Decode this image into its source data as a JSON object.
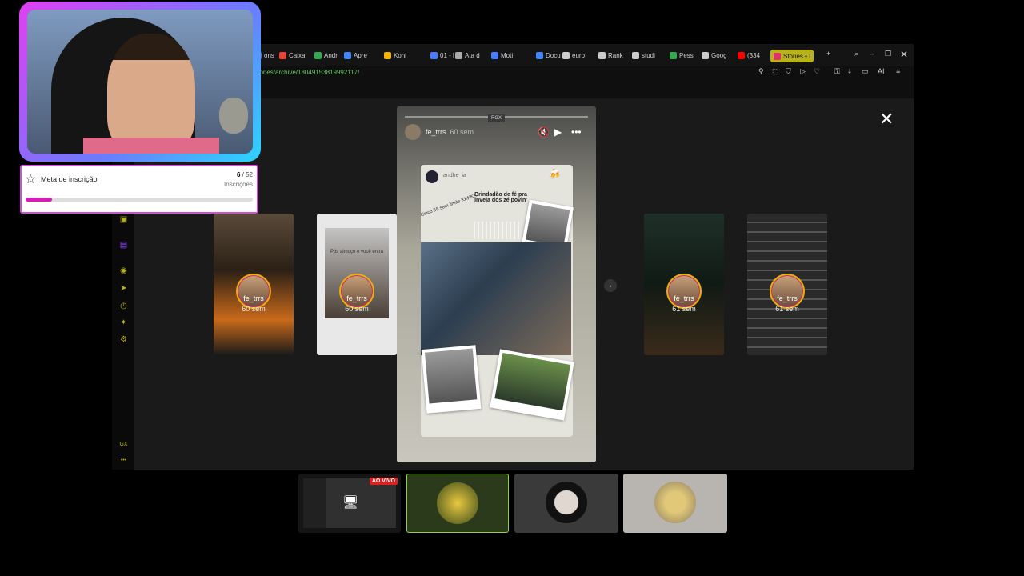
{
  "browser": {
    "tabs": [
      {
        "label": "ons",
        "color": "#3b6fd1"
      },
      {
        "label": "Caixa",
        "color": "#ea4335"
      },
      {
        "label": "Andr",
        "color": "#34a853"
      },
      {
        "label": "Apre",
        "color": "#4285f4"
      },
      {
        "label": "Koni",
        "color": "#f4b400"
      },
      {
        "label": "01 - l",
        "color": "#4a7cff"
      },
      {
        "label": "Ata d",
        "color": "#aaaaaa"
      },
      {
        "label": "Moti",
        "color": "#4a7cff"
      },
      {
        "label": "Docu",
        "color": "#4285f4"
      },
      {
        "label": "euro",
        "color": "#cccccc"
      },
      {
        "label": "Rank",
        "color": "#cccccc"
      },
      {
        "label": "studi",
        "color": "#cccccc"
      },
      {
        "label": "Pess",
        "color": "#34a853"
      },
      {
        "label": "Goog",
        "color": "#cccccc"
      },
      {
        "label": "(334",
        "color": "#ff0000"
      }
    ],
    "active_tab": {
      "label": "Stories • I"
    },
    "url": "/stories/archive/18049153819992117/",
    "toolbar_ai": "AI"
  },
  "story": {
    "badge": "RGX",
    "username": "fe_trrs",
    "time": "60 sem",
    "inner_username": "andhe_ia",
    "caption": "Brindadão de fé pra inveja dos zé povin'",
    "diagonal_text": "Cinco 55 sem limite KKKKK"
  },
  "thumbs": [
    {
      "name": "fe_trrs",
      "time": "60 sem",
      "bg": "#3a2a1a"
    },
    {
      "name": "fe_trrs",
      "time": "60 sem",
      "bg": "#e0e0e0",
      "overlay_text": "Pós almoço e você entra"
    },
    {
      "name": "fe_trrs",
      "time": "61 sem",
      "bg": "#1d2b22"
    },
    {
      "name": "fe_trrs",
      "time": "61 sem",
      "bg": "#2a2a2a"
    }
  ],
  "subgoal": {
    "title": "Meta de inscrição",
    "current": "6",
    "total": "52",
    "separator": "/",
    "label": "Inscrições",
    "progress": 0.115
  },
  "sidebar": {
    "bottom_label": "GX",
    "more": "•••"
  },
  "bottom_tiles": {
    "live_badge": "AO VIVO"
  },
  "colors": {
    "accent": "#b9b21a",
    "live": "#e02020",
    "goal": "#d21fb8"
  }
}
